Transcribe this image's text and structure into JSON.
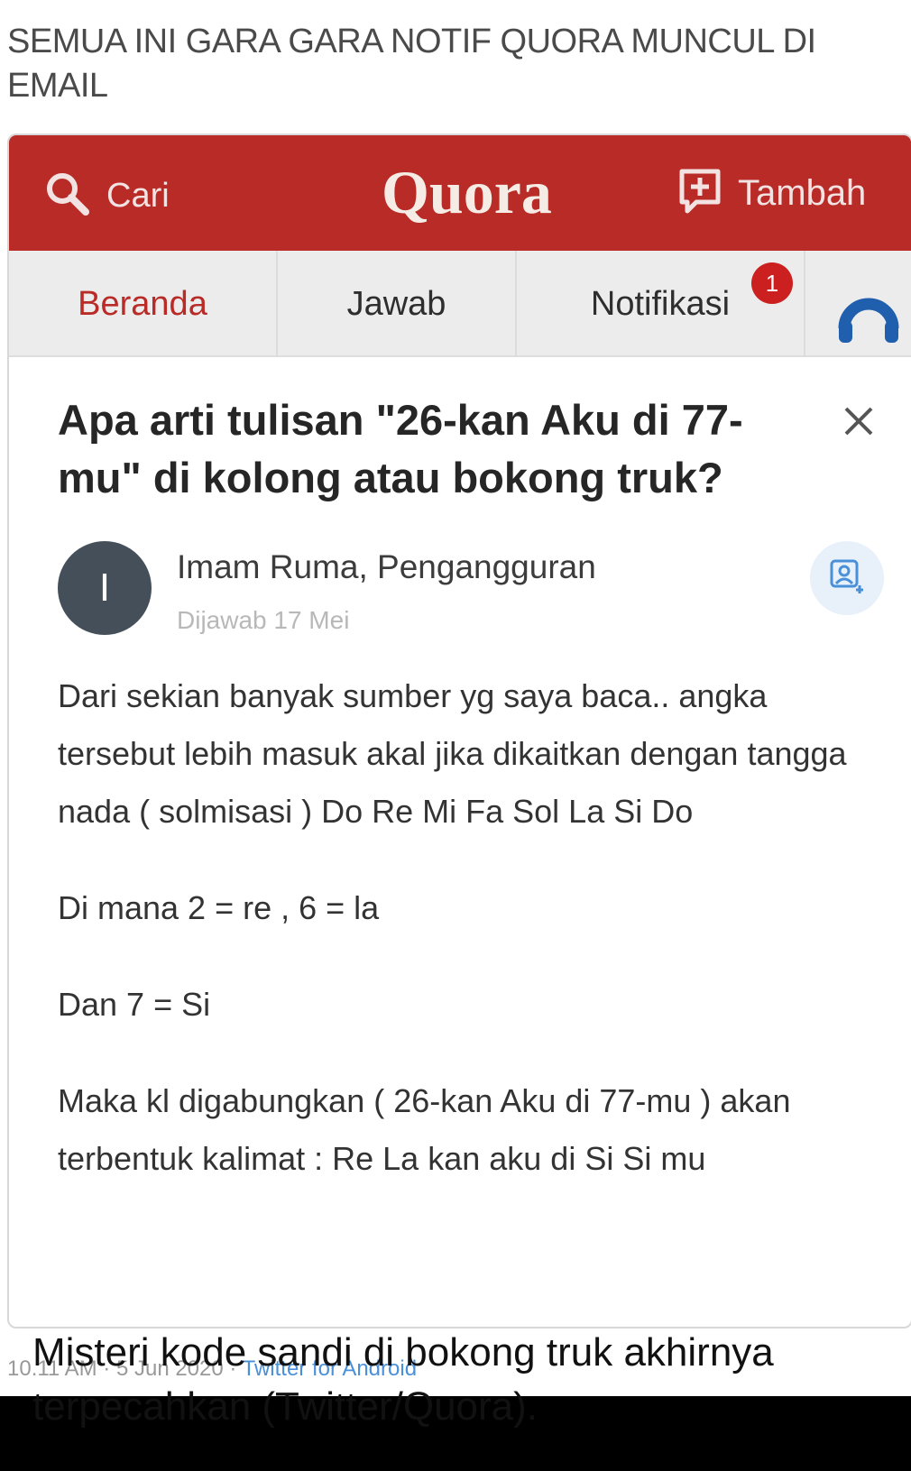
{
  "tweet": {
    "text": "SEMUA INI GARA GARA NOTIF QUORA MUNCUL DI EMAIL",
    "timestamp": "10.11 AM · 5 Jun 2020 ·",
    "client": "Twitter for Android"
  },
  "quora": {
    "header": {
      "search_label": "Cari",
      "logo": "Quora",
      "add_label": "Tambah",
      "brand_color": "#b92b27"
    },
    "tabs": [
      {
        "label": "Beranda",
        "active": true
      },
      {
        "label": "Jawab",
        "active": false
      },
      {
        "label": "Notifikasi",
        "active": false
      }
    ],
    "notification_count": "1",
    "question": "Apa arti tulisan \"26-kan Aku di 77-mu\" di kolong atau bokong truk?",
    "author": {
      "initial": "I",
      "name": "Imam Ruma, Pengangguran",
      "answered": "Dijawab 17 Mei"
    },
    "answer_paragraphs": [
      "Dari sekian banyak sumber yg saya baca.. angka tersebut lebih masuk akal jika dikaitkan dengan tangga nada ( solmisasi ) Do Re Mi Fa Sol La Si Do",
      "Di mana 2 = re , 6 = la",
      "Dan 7 = Si",
      "Maka kl digabungkan ( 26-kan Aku di 77-mu ) akan terbentuk kalimat : Re La kan aku di Si Si mu"
    ]
  },
  "caption": "Misteri kode sandi di bokong truk akhirnya terpecahkan (Twitter/Quora).",
  "icons": {
    "search": "search-icon",
    "add": "add-post-icon",
    "close": "close-icon",
    "profile": "profile-icon",
    "follow": "follow-user-icon"
  }
}
